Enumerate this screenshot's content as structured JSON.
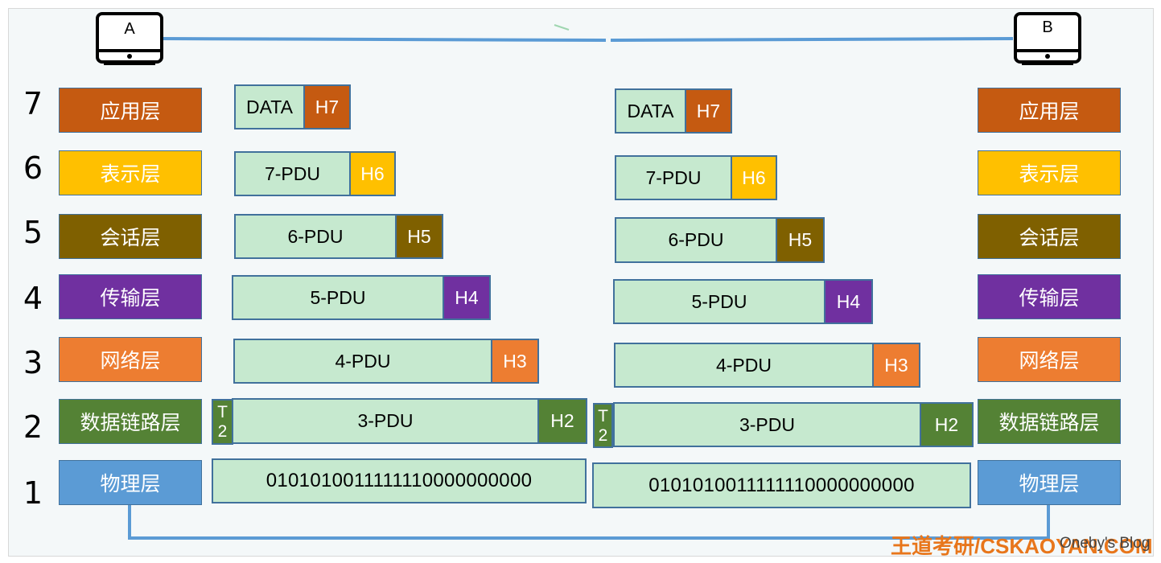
{
  "computers": {
    "a": "A",
    "b": "B"
  },
  "layer_numbers": [
    "7",
    "6",
    "5",
    "4",
    "3",
    "2",
    "1"
  ],
  "layers": [
    {
      "name": "应用层",
      "color": "#c55a11"
    },
    {
      "name": "表示层",
      "color": "#ffc000"
    },
    {
      "name": "会话层",
      "color": "#7f6000"
    },
    {
      "name": "传输层",
      "color": "#7030a0"
    },
    {
      "name": "网络层",
      "color": "#ed7d31"
    },
    {
      "name": "数据链路层",
      "color": "#548235"
    },
    {
      "name": "物理层",
      "color": "#5b9bd5"
    }
  ],
  "pdus": {
    "l7": {
      "data": "DATA",
      "header": "H7"
    },
    "l6": {
      "data": "7-PDU",
      "header": "H6"
    },
    "l5": {
      "data": "6-PDU",
      "header": "H5"
    },
    "l4": {
      "data": "5-PDU",
      "header": "H4"
    },
    "l3": {
      "data": "4-PDU",
      "header": "H3"
    },
    "l2": {
      "data": "3-PDU",
      "header": "H2",
      "trailer_top": "T",
      "trailer_bottom": "2"
    },
    "l1": {
      "bits": "0101010011111110000000000"
    }
  },
  "watermark": {
    "site": "王道考研/CSKAOYAN.COM",
    "blog": "Oneby's Blog"
  },
  "colors": {
    "pdu_fill": "#c6e9cf",
    "border": "#41719c",
    "link_line": "#5b9bd5"
  }
}
